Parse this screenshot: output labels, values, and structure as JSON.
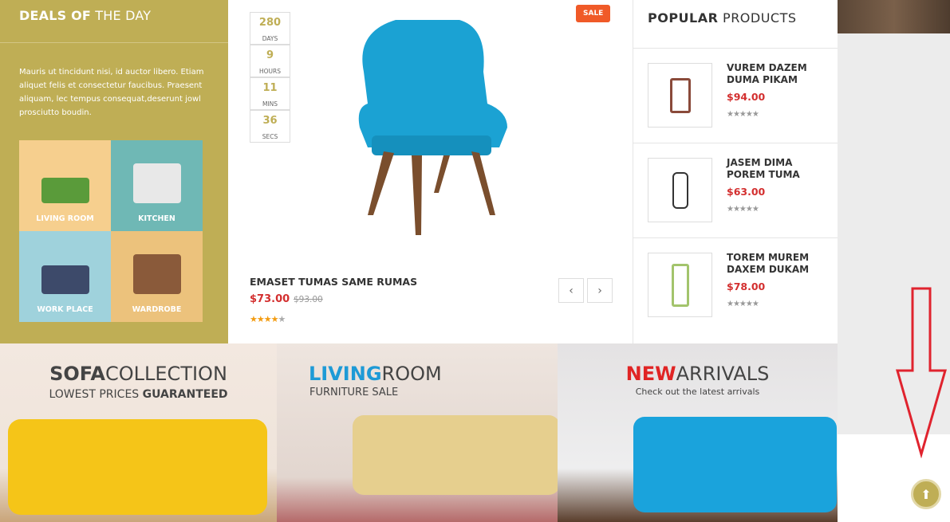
{
  "deals": {
    "title_bold": "DEALS OF",
    "title_rest": " THE DAY",
    "description": "Mauris ut tincidunt nisi, id auctor libero. Etiam aliquet felis et consectetur faucibus. Praesent aliquam, lec tempus consequat,deserunt jowl prosciutto boudin.",
    "categories": [
      {
        "label": "LIVING ROOM",
        "color": "#f6cf8e"
      },
      {
        "label": "KITCHEN",
        "color": "#6fb8b5"
      },
      {
        "label": "WORK PLACE",
        "color": "#9fd2dc"
      },
      {
        "label": "WARDROBE",
        "color": "#ecc27c"
      }
    ]
  },
  "countdown": [
    {
      "value": "280",
      "unit": "DAYS"
    },
    {
      "value": "9",
      "unit": "HOURS"
    },
    {
      "value": "11",
      "unit": "MINS"
    },
    {
      "value": "36",
      "unit": "SECS"
    }
  ],
  "featured": {
    "badge": "SALE",
    "name": "EMASET TUMAS SAME RUMAS",
    "price": "$73.00",
    "old_price": "$93.00",
    "rating": 4,
    "rating_max": 5,
    "prev_icon": "chevron-left-icon",
    "next_icon": "chevron-right-icon"
  },
  "popular": {
    "title_bold": "POPULAR",
    "title_rest": " PRODUCTS",
    "items": [
      {
        "name": "VUREM DAZEM DUMA PIKAM",
        "price": "$94.00",
        "rating": 0
      },
      {
        "name": "JASEM DIMA POREM TUMA",
        "price": "$63.00",
        "rating": 0
      },
      {
        "name": "TOREM MUREM DAXEM DUKAM",
        "price": "$78.00",
        "rating": 0
      }
    ]
  },
  "banners": [
    {
      "title_bold": "SOFA",
      "title_rest": "COLLECTION",
      "sub_a": "LOWEST PRICES ",
      "sub_b": "GUARANTEED",
      "accent": "#444444"
    },
    {
      "title_bold": "LIVING",
      "title_rest": "ROOM",
      "sub_a": "FURNITURE SALE",
      "sub_b": "",
      "accent": "#1e9ad6"
    },
    {
      "title_bold": "NEW",
      "title_rest": "ARRIVALS",
      "sub_a": "Check out the latest arrivals",
      "sub_b": "",
      "accent": "#e02424"
    }
  ],
  "scroll_top_icon": "arrow-up-icon"
}
